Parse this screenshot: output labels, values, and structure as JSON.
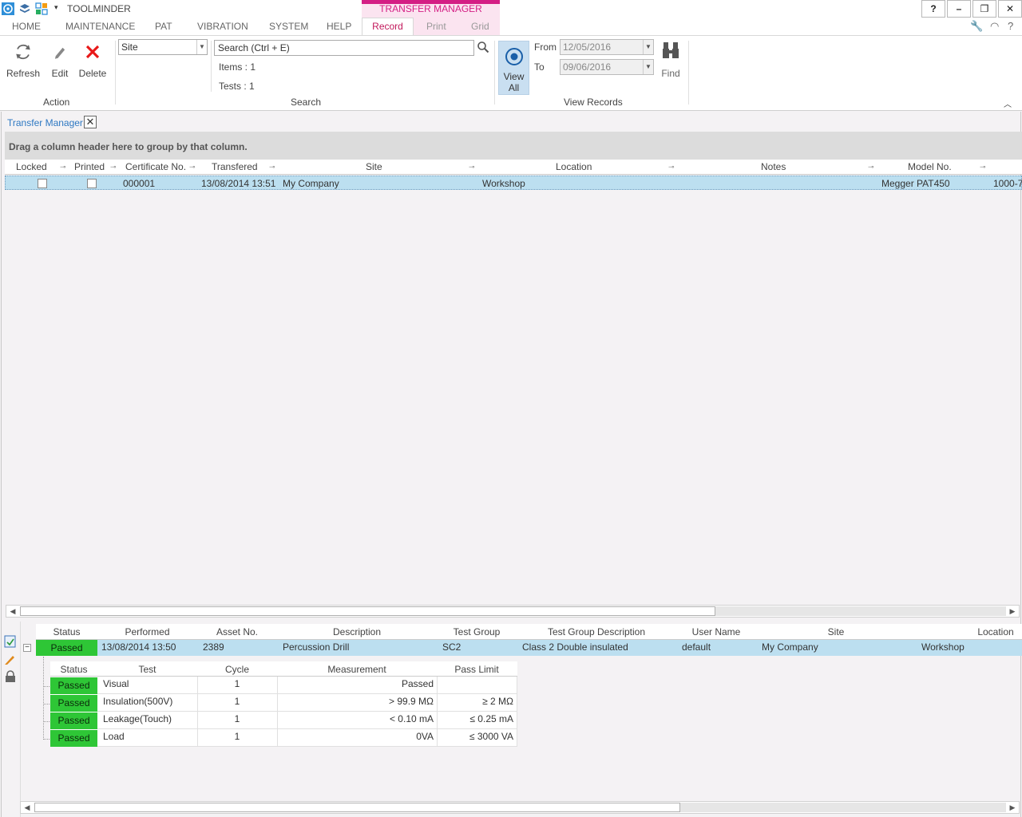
{
  "app": {
    "title": "TOOLMINDER",
    "context_tab_header": "TRANSFER MANAGER"
  },
  "window_buttons": {
    "help": "?",
    "minimize": "–",
    "restore": "❐",
    "close": "✕"
  },
  "menu": {
    "home": "HOME",
    "maintenance": "MAINTENANCE",
    "pat": "PAT",
    "vibration": "VIBRATION",
    "system": "SYSTEM",
    "help": "HELP",
    "record": "Record",
    "print": "Print",
    "grid": "Grid"
  },
  "ribbon": {
    "refresh": "Refresh",
    "edit": "Edit",
    "delete": "Delete",
    "group_action": "Action",
    "site_combo_value": "Site",
    "search_placeholder": "Search (Ctrl + E)",
    "items": "Items : 1",
    "tests": "Tests : 1",
    "group_search": "Search",
    "view_all_1": "View",
    "view_all_2": "All",
    "from_label": "From",
    "to_label": "To",
    "from_date": "12/05/2016",
    "to_date": "09/06/2016",
    "find": "Find",
    "group_view_records": "View Records"
  },
  "document_tab": {
    "label": "Transfer Manager",
    "close": "✕"
  },
  "grid": {
    "group_hint": "Drag a column header here to group by that column.",
    "columns": [
      "Locked",
      "Printed",
      "Certificate No.",
      "Transfered",
      "Site",
      "Location",
      "Notes",
      "Model No."
    ],
    "row": {
      "certificate_no": "000001",
      "transfered": "13/08/2014 13:51",
      "site": "My Company",
      "location": "Workshop",
      "notes": "",
      "model_no": "Megger PAT450",
      "serial_partial": "1000-7"
    }
  },
  "detail": {
    "columns": [
      "Status",
      "Performed",
      "Asset No.",
      "Description",
      "Test Group",
      "Test Group Description",
      "User Name",
      "Site",
      "Location"
    ],
    "row": {
      "status": "Passed",
      "performed": "13/08/2014 13:50",
      "asset_no": "2389",
      "description": "Percussion Drill",
      "test_group": "SC2",
      "test_group_description": "Class 2 Double insulated",
      "user_name": "default",
      "site": "My Company",
      "location": "Workshop"
    },
    "sub_columns": [
      "Status",
      "Test",
      "Cycle",
      "Measurement",
      "Pass Limit"
    ],
    "sub_rows": [
      {
        "status": "Passed",
        "test": "Visual",
        "cycle": "1",
        "measurement": "Passed",
        "pass_limit": ""
      },
      {
        "status": "Passed",
        "test": "Insulation(500V)",
        "cycle": "1",
        "measurement": "> 99.9 MΩ",
        "pass_limit": "≥ 2 MΩ"
      },
      {
        "status": "Passed",
        "test": "Leakage(Touch)",
        "cycle": "1",
        "measurement": "< 0.10 mA",
        "pass_limit": "≤ 0.25 mA"
      },
      {
        "status": "Passed",
        "test": "Load",
        "cycle": "1",
        "measurement": "0VA",
        "pass_limit": "≤ 3000 VA"
      }
    ]
  },
  "colors": {
    "accent_magenta": "#d41e84",
    "selection_blue": "#bcdff0",
    "passed_green": "#2ec636",
    "link_blue": "#2e78c2"
  }
}
